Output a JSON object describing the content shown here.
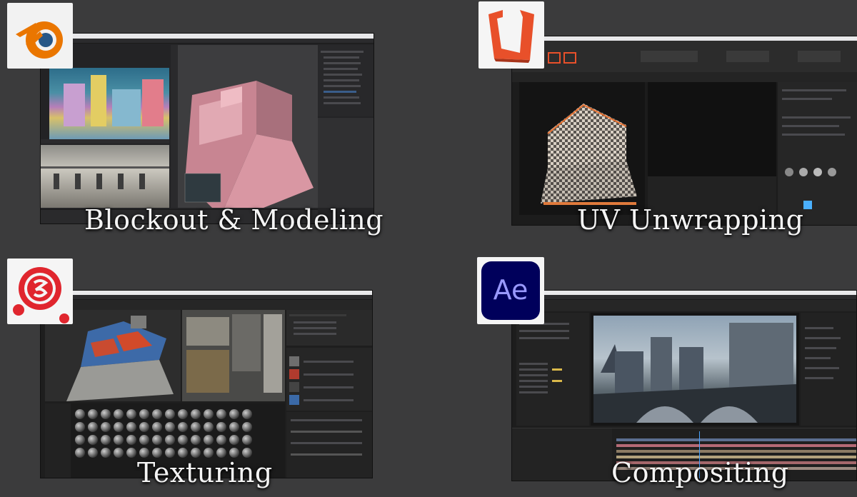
{
  "panels": [
    {
      "app": "Blender",
      "logo_icon": "blender-logo",
      "caption": "Blockout & Modeling",
      "accent": "#ea7600"
    },
    {
      "app": "RizomUV",
      "logo_icon": "rizomuv-logo",
      "caption": "UV Unwrapping",
      "accent": "#e8502a"
    },
    {
      "app": "Substance Painter",
      "logo_icon": "substance-painter-logo",
      "caption": "Texturing",
      "accent": "#e0262e"
    },
    {
      "app": "After Effects",
      "logo_icon": "after-effects-logo",
      "logo_text": "Ae",
      "caption": "Compositing",
      "accent": "#9999ff"
    }
  ]
}
